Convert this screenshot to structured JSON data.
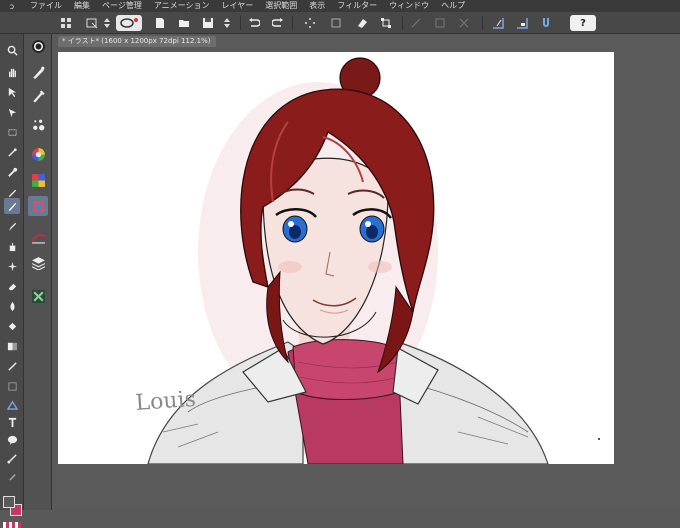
{
  "menubar": {
    "logo": "ↄ",
    "items": [
      "ファイル",
      "編集",
      "ページ管理",
      "アニメーション",
      "レイヤー",
      "選択範囲",
      "表示",
      "フィルター",
      "ウィンドウ",
      "ヘルプ"
    ]
  },
  "toolbar": {
    "help_label": "?"
  },
  "document": {
    "tab_title": "* イラスト* (1600 x 1200px 72dpi 112.1%)"
  },
  "artwork": {
    "signature": "Louis"
  },
  "colors": {
    "main_color": "#5a5a5a",
    "sub_color": "#c23a60",
    "accent": "#6a7a94"
  }
}
